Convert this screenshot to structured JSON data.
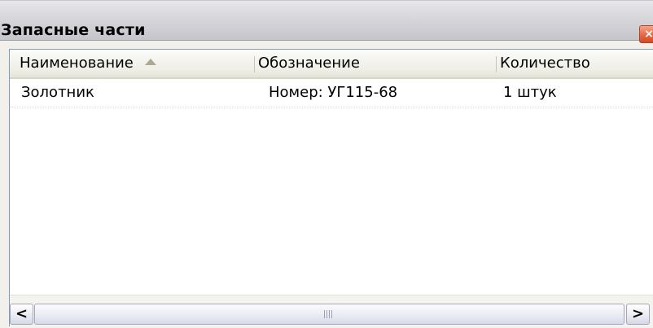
{
  "window": {
    "title": "Запасные части",
    "close_label": "×"
  },
  "grid": {
    "columns": [
      {
        "label": "Наименование",
        "sorted": "ascending"
      },
      {
        "label": "Обозначение"
      },
      {
        "label": "Количество"
      }
    ],
    "rows": [
      {
        "name": "Золотник",
        "designation": "Номер: УГ115-68",
        "quantity": "1 штук"
      }
    ]
  },
  "scrollbar": {
    "left_arrow": "<",
    "right_arrow": ">"
  }
}
